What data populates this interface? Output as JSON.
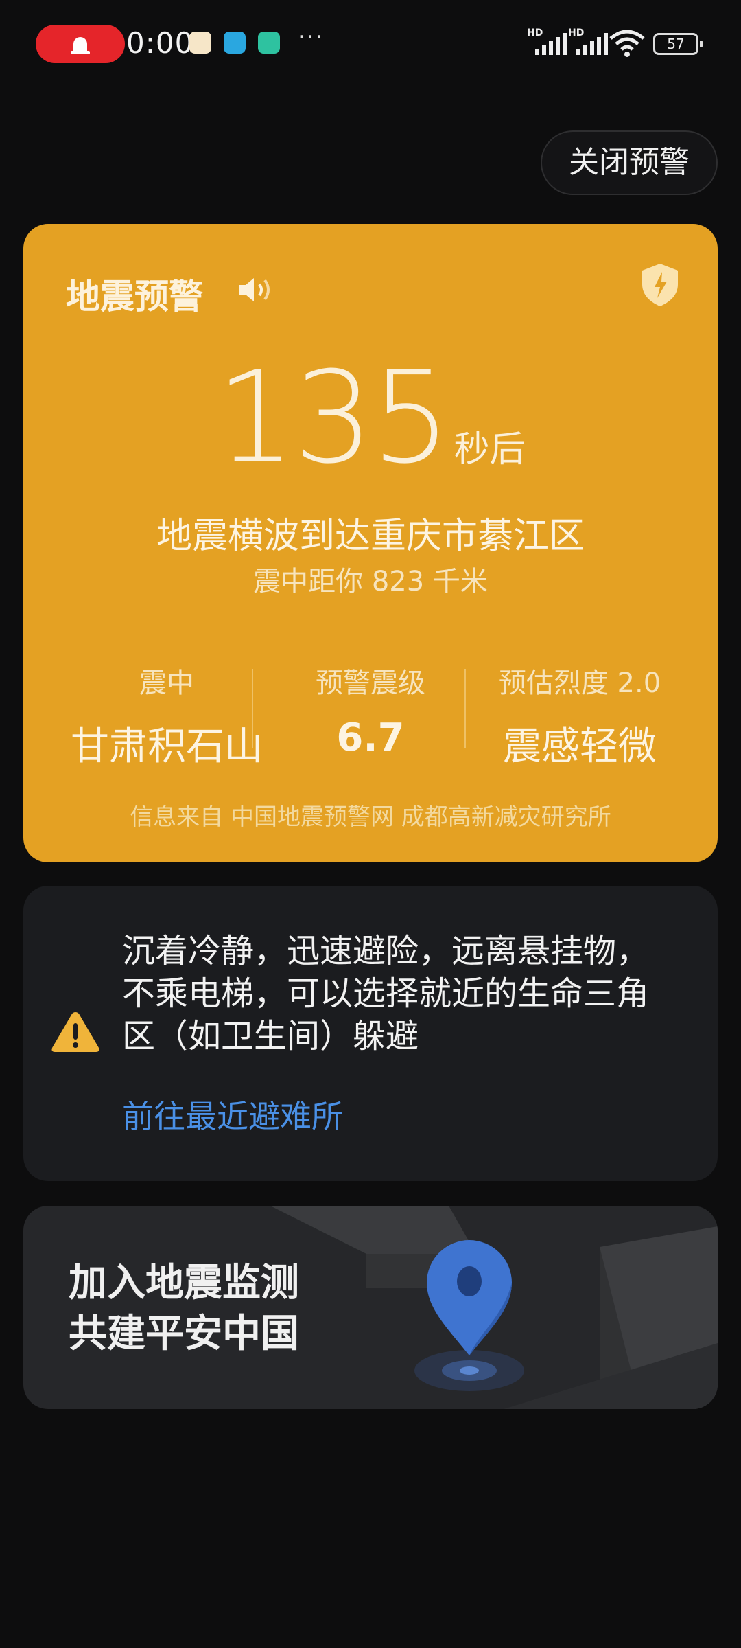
{
  "status_bar": {
    "time": "0:00",
    "more": "···",
    "signal1_label": "HD",
    "signal2_label": "HD",
    "battery": "57",
    "colors": {
      "alert_pill": "#e5252a"
    }
  },
  "header": {
    "close_button": "关闭预警"
  },
  "warning": {
    "title": "地震预警",
    "countdown": "135",
    "countdown_unit": "秒后",
    "arrival": "地震横波到达重庆市綦江区",
    "distance": "震中距你 823 千米",
    "stats": [
      {
        "label": "震中",
        "value": "甘肃积石山"
      },
      {
        "label": "预警震级",
        "value": "6.7"
      },
      {
        "label": "预估烈度 2.0",
        "value": "震感轻微"
      }
    ],
    "source": "信息来自 中国地震预警网 成都高新减灾研究所",
    "colors": {
      "card": "#e4a123"
    },
    "icons": {
      "speaker": "speaker-icon",
      "shield": "shield-icon"
    }
  },
  "advice": {
    "text": "沉着冷静，迅速避险，远离悬挂物，不乘电梯，可以选择就近的生命三角区（如卫生间）躲避",
    "link": "前往最近避难所",
    "colors": {
      "link": "#4a90e6",
      "icon": "#f0b43a"
    },
    "icons": {
      "alert": "warning-triangle-icon"
    }
  },
  "join": {
    "line1": "加入地震监测",
    "line2": "共建平安中国",
    "icons": {
      "pin": "location-pin-icon"
    }
  }
}
